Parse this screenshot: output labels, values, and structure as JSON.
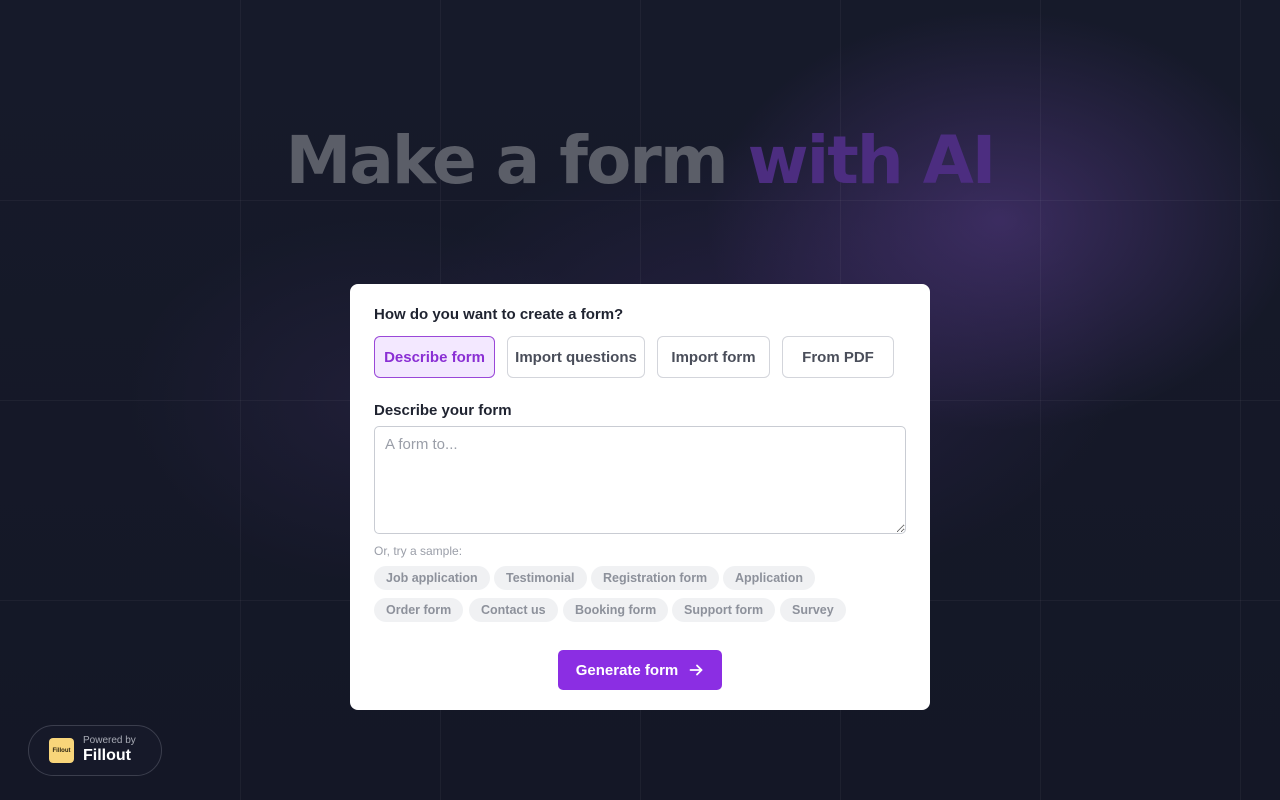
{
  "headline": {
    "main": "Make a form",
    "accent": "with AI"
  },
  "form": {
    "question": "How do you want to create a form?",
    "tabs": [
      {
        "label": "Describe form",
        "active": true
      },
      {
        "label": "Import questions",
        "active": false
      },
      {
        "label": "Import form",
        "active": false
      },
      {
        "label": "From PDF",
        "active": false
      }
    ],
    "describe_label": "Describe your form",
    "describe_placeholder": "A form to...",
    "describe_value": "",
    "sample_label": "Or, try a sample:",
    "samples": [
      "Job application",
      "Testimonial",
      "Registration form",
      "Application",
      "Order form",
      "Contact us",
      "Booking form",
      "Support form",
      "Survey"
    ],
    "generate_label": "Generate form"
  },
  "powered": {
    "small": "Powered by",
    "brand": "Fillout",
    "logo_text": "Fillout"
  },
  "colors": {
    "accent": "#8b2ee3",
    "background": "#141726",
    "active_tab_bg": "#f3e8ff",
    "logo_yellow": "#f8d57a"
  },
  "icons": {
    "generate": "arrow-right-icon"
  }
}
